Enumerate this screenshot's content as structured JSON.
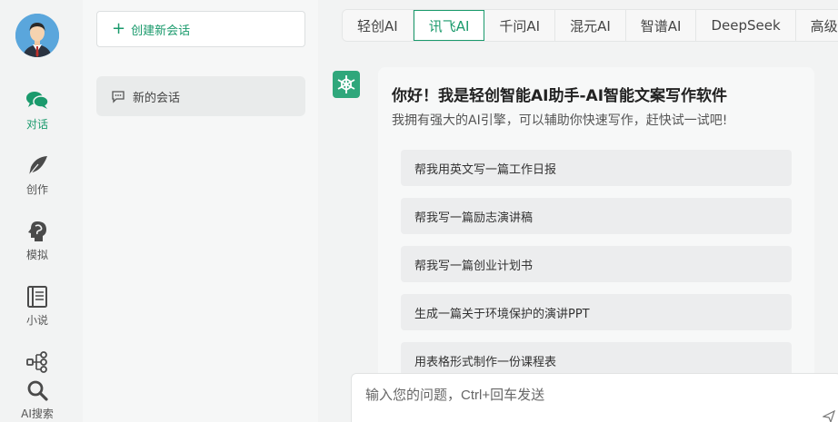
{
  "nav": {
    "items": [
      {
        "label": "对话",
        "icon": "chat-bubbles-icon"
      },
      {
        "label": "创作",
        "icon": "feather-icon"
      },
      {
        "label": "模拟",
        "icon": "head-profile-icon"
      },
      {
        "label": "小说",
        "icon": "book-icon"
      },
      {
        "label": "",
        "icon": "flow-diagram-icon"
      },
      {
        "label": "AI搜索",
        "icon": "search-icon"
      }
    ]
  },
  "sessions": {
    "new_label": "创建新会话",
    "items": [
      {
        "label": "新的会话"
      }
    ]
  },
  "tabs": [
    "轻创AI",
    "讯飞AI",
    "千问AI",
    "混元AI",
    "智谱AI",
    "DeepSeek",
    "高级"
  ],
  "greeting": {
    "title": "你好！我是轻创智能AI助手-AI智能文案写作软件",
    "subtitle": "我拥有强大的AI引擎，可以辅助你快速写作，赶快试一试吧!"
  },
  "suggestions": [
    "帮我用英文写一篇工作日报",
    "帮我写一篇励志演讲稿",
    "帮我写一篇创业计划书",
    "生成一篇关于环境保护的演讲PPT",
    "用表格形式制作一份课程表"
  ],
  "input": {
    "placeholder": "输入您的问题，Ctrl+回车发送",
    "value": ""
  },
  "colors": {
    "accent": "#1a9a6c"
  }
}
